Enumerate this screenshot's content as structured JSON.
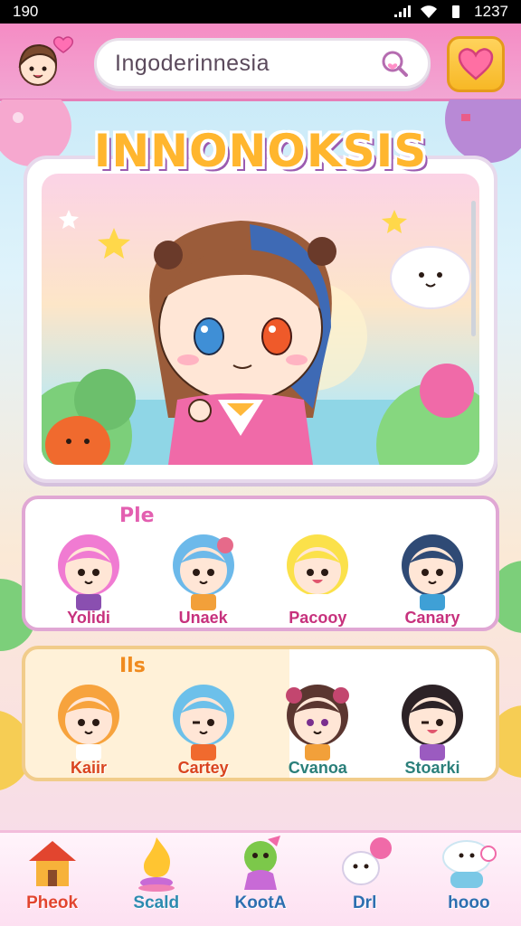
{
  "status_bar": {
    "time": "190",
    "clock": "1237"
  },
  "header": {
    "search": {
      "value": "Ingoderinnesia"
    }
  },
  "title": "INNONOKSIS",
  "panels": [
    {
      "label": "Ple",
      "characters": [
        {
          "name": "Yolidi",
          "hair": "#f07bd2"
        },
        {
          "name": "Unaek",
          "hair": "#6cb9ea"
        },
        {
          "name": "Pacooy",
          "hair": "#fbe14a"
        },
        {
          "name": "Canary",
          "hair": "#2f4a75"
        }
      ]
    },
    {
      "label": "Ils",
      "characters": [
        {
          "name": "Kaiir",
          "hair": "#f7a33d"
        },
        {
          "name": "Cartey",
          "hair": "#6cc0ea"
        },
        {
          "name": "Cvanoa",
          "hair": "#5b3630"
        },
        {
          "name": "Stoarki",
          "hair": "#2c2226"
        }
      ]
    }
  ],
  "bottom_nav": [
    {
      "label": "Pheok",
      "icon": "house-icon",
      "color": "#e2452f"
    },
    {
      "label": "Scald",
      "icon": "flame-icon",
      "color": "#2d8bb0"
    },
    {
      "label": "KootA",
      "icon": "mascot-icon",
      "color": "#2d6fb0"
    },
    {
      "label": "Drl",
      "icon": "ghost-icon",
      "color": "#2d6fb0"
    },
    {
      "label": "hooo",
      "icon": "cloud-icon",
      "color": "#2d6fb0"
    }
  ],
  "colors": {
    "header_pink": "#f58cc4",
    "accent_yellow": "#ffd35c",
    "panel_pink_border": "#e0a7d4",
    "panel_orange_border": "#f1cc8a"
  }
}
